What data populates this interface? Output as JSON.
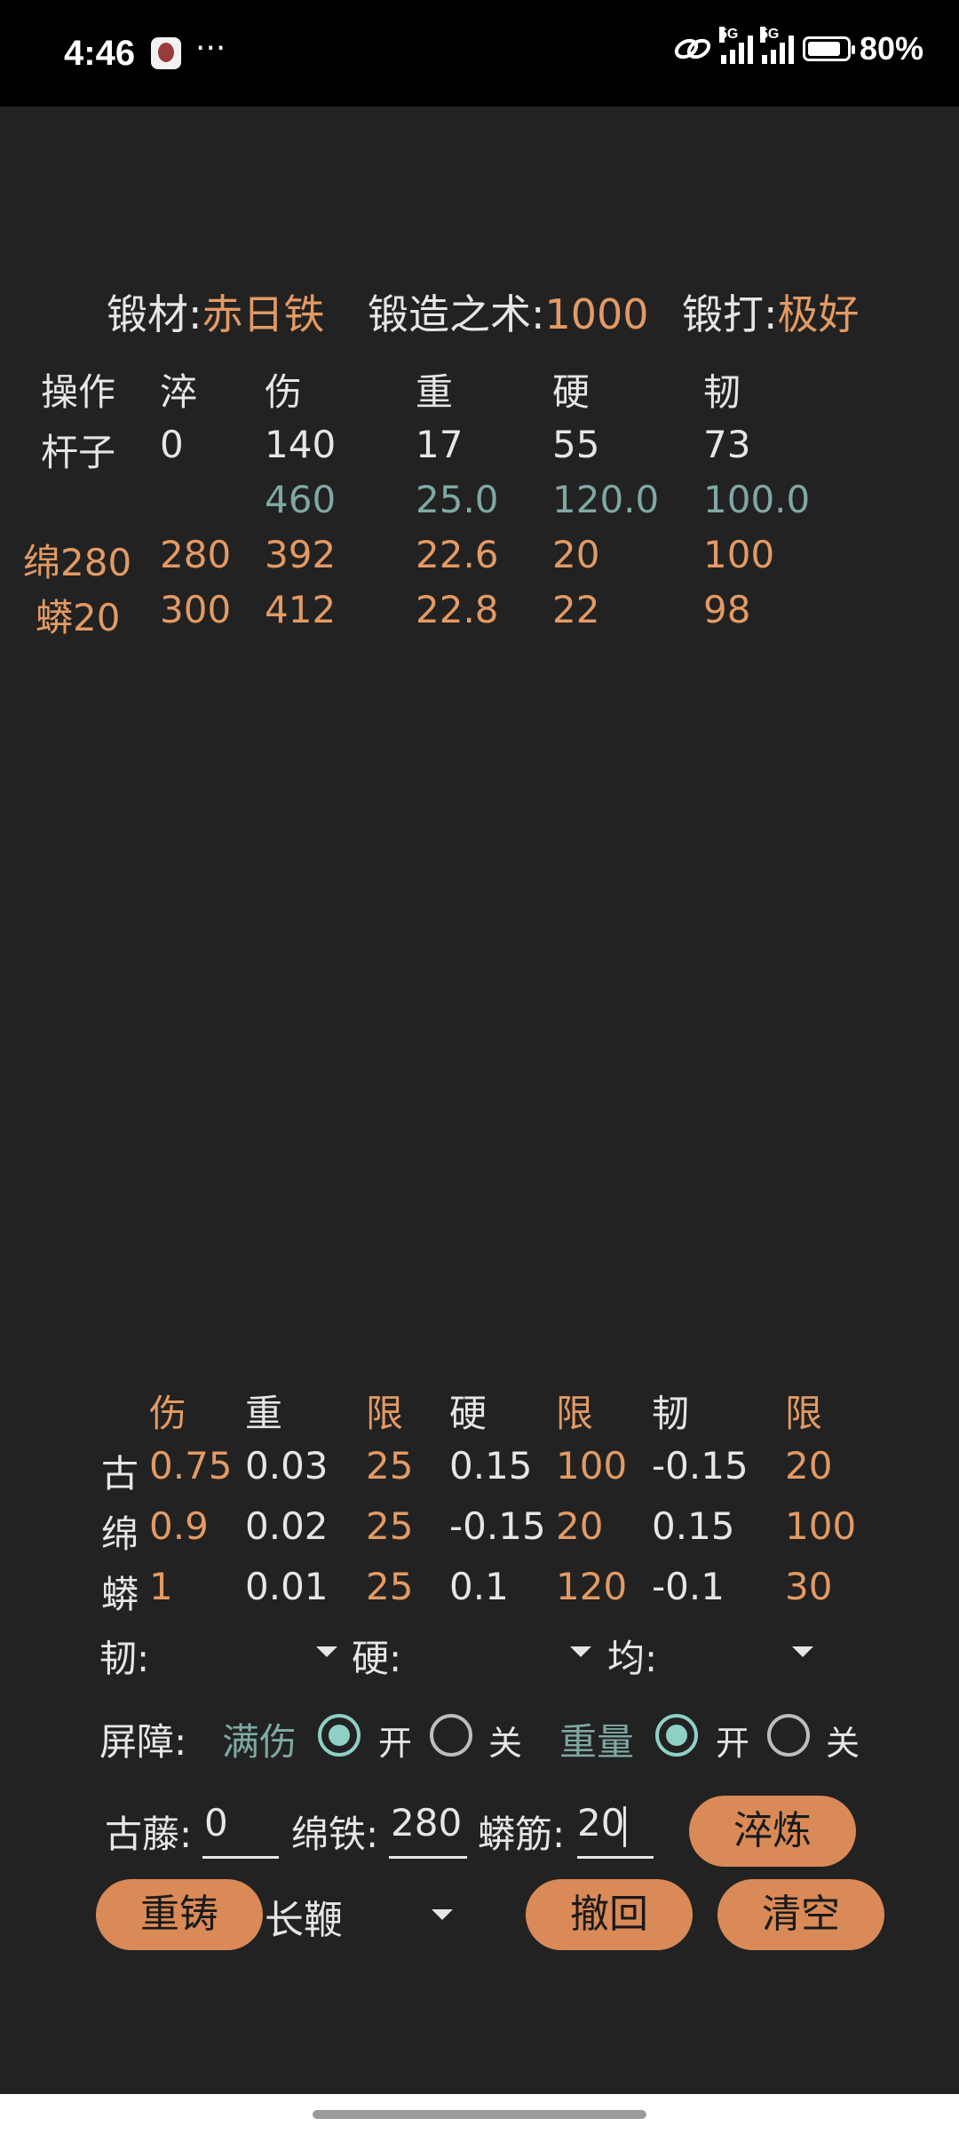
{
  "status_bar": {
    "time": "4:46",
    "dots": "···",
    "network": "5G",
    "battery": "80%"
  },
  "summary": {
    "material_label": "锻材:",
    "material_value": "赤日铁",
    "skill_label": "锻造之术:",
    "skill_value": "1000",
    "forge_label": "锻打:",
    "forge_value": "极好"
  },
  "main_table": {
    "headers": [
      "操作",
      "淬",
      "伤",
      "重",
      "硬",
      "韧"
    ],
    "rows": [
      [
        "杆子",
        "0",
        "140",
        "17",
        "55",
        "73"
      ],
      [
        "",
        "",
        "460",
        "25.0",
        "120.0",
        "100.0"
      ],
      [
        "绵280",
        "280",
        "392",
        "22.6",
        "20",
        "100"
      ],
      [
        "蟒20",
        "300",
        "412",
        "22.8",
        "22",
        "98"
      ]
    ]
  },
  "coef_table": {
    "headers": [
      "伤",
      "重",
      "限",
      "硬",
      "限",
      "韧",
      "限"
    ],
    "rows": [
      [
        "古",
        "0.75",
        "0.03",
        "25",
        "0.15",
        "100",
        "-0.15",
        "20"
      ],
      [
        "绵",
        "0.9",
        "0.02",
        "25",
        "-0.15",
        "20",
        "0.15",
        "100"
      ],
      [
        "蟒",
        "1",
        "0.01",
        "25",
        "0.1",
        "120",
        "-0.1",
        "30"
      ]
    ]
  },
  "selectors": {
    "toughness_label": "韧:",
    "hardness_label": "硬:",
    "average_label": "均:"
  },
  "shield": {
    "label": "屏障:",
    "full_damage": "满伤",
    "weight": "重量",
    "on": "开",
    "off": "关"
  },
  "inputs": {
    "guteng_label": "古藤:",
    "guteng_value": "0",
    "mianti_label": "绵铁:",
    "mianti_value": "280",
    "mangjin_label": "蟒筋:",
    "mangjin_value": "20"
  },
  "buttons": {
    "quench": "淬炼",
    "recast": "重铸",
    "weapon_value": "长鞭",
    "undo": "撤回",
    "clear": "清空"
  }
}
